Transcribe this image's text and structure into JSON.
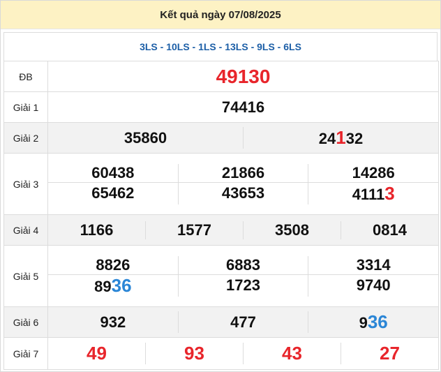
{
  "header": {
    "title": "Kết quả ngày 07/08/2025"
  },
  "codes": "3LS - 10LS - 1LS - 13LS - 9LS - 6LS",
  "prizes": {
    "db": {
      "label": "ĐB",
      "value": "49130"
    },
    "g1": {
      "label": "Giải 1",
      "value": "74416"
    },
    "g2": {
      "label": "Giải 2",
      "values": [
        "35860",
        "24132"
      ]
    },
    "g3": {
      "label": "Giải 3",
      "values": [
        "60438",
        "21866",
        "14286",
        "65462",
        "43653",
        "41113"
      ]
    },
    "g4": {
      "label": "Giải 4",
      "values": [
        "1166",
        "1577",
        "3508",
        "0814"
      ]
    },
    "g5": {
      "label": "Giải 5",
      "values": [
        "8826",
        "6883",
        "3314",
        "8936",
        "1723",
        "9740"
      ]
    },
    "g6": {
      "label": "Giải 6",
      "values": [
        "932",
        "477",
        "936"
      ]
    },
    "g7": {
      "label": "Giải 7",
      "values": [
        "49",
        "93",
        "43",
        "27"
      ]
    }
  },
  "highlights": {
    "g2_1": {
      "prefix": "24",
      "mark": "1",
      "suffix": "32"
    },
    "g3_5": {
      "prefix": "4111",
      "mark": "3",
      "suffix": ""
    },
    "g5_3": {
      "prefix": "89",
      "mark": "36",
      "suffix": ""
    },
    "g6_2": {
      "prefix": "9",
      "mark": "36",
      "suffix": ""
    }
  },
  "colors": {
    "red": "#e8252b",
    "blue": "#2b86d6",
    "title_bg": "#fdf2c4",
    "codes_text": "#1d5fa7"
  }
}
